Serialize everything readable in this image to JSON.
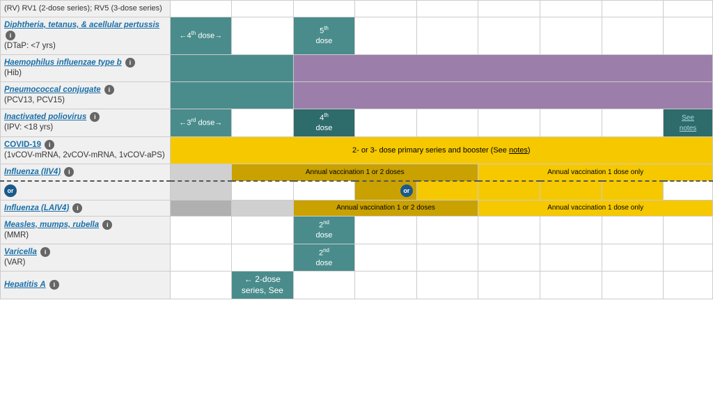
{
  "vaccines": [
    {
      "id": "dtap",
      "nameLink": "Diphtheria, tetanus, & acellular pertussis",
      "nameSub": "(DTaP: <7 yrs)",
      "hasInfo": true,
      "rowType": "normal",
      "cells": [
        {
          "span": 1,
          "color": "teal",
          "text": "←4th dose→",
          "textSize": "small"
        },
        {
          "span": 1,
          "color": "white"
        },
        {
          "span": 1,
          "color": "teal",
          "text": "5th dose",
          "sup": "th",
          "baseText": "5"
        },
        {
          "span": 1,
          "color": "white"
        },
        {
          "span": 1,
          "color": "white"
        },
        {
          "span": 1,
          "color": "white"
        },
        {
          "span": 1,
          "color": "white"
        },
        {
          "span": 1,
          "color": "white"
        },
        {
          "span": 1,
          "color": "white"
        }
      ]
    },
    {
      "id": "hib",
      "nameLink": "Haemophilus influenzae type b",
      "nameSub": "(Hib)",
      "hasInfo": true,
      "rowType": "normal",
      "cells": [
        {
          "span": 2,
          "color": "teal"
        },
        {
          "span": 7,
          "color": "purple"
        }
      ]
    },
    {
      "id": "pcv",
      "nameLink": "Pneumococcal conjugate",
      "nameSub": "(PCV13, PCV15)",
      "hasInfo": true,
      "rowType": "normal",
      "cells": [
        {
          "span": 2,
          "color": "teal"
        },
        {
          "span": 7,
          "color": "purple"
        }
      ]
    },
    {
      "id": "ipv",
      "nameLink": "Inactivated poliovirus",
      "nameSub": "(IPV: <18 yrs)",
      "hasInfo": true,
      "rowType": "normal",
      "cells": [
        {
          "span": 1,
          "color": "teal",
          "text": "←3rd dose→",
          "textSize": "small"
        },
        {
          "span": 1,
          "color": "white"
        },
        {
          "span": 1,
          "color": "teal-dark",
          "text": "4th dose",
          "supText": "th",
          "baseText": "4"
        },
        {
          "span": 1,
          "color": "white"
        },
        {
          "span": 1,
          "color": "white"
        },
        {
          "span": 1,
          "color": "white"
        },
        {
          "span": 1,
          "color": "white"
        },
        {
          "span": 1,
          "color": "white"
        },
        {
          "span": 1,
          "color": "teal-dark",
          "text": "See notes",
          "link": true
        }
      ]
    },
    {
      "id": "covid",
      "nameLink": "COVID-19",
      "nameSub": "(1vCOV-mRNA, 2vCOV-mRNA, 1vCOV-aPS)",
      "hasInfo": true,
      "rowType": "wide",
      "cells": [
        {
          "span": 9,
          "color": "yellow",
          "text": "2- or 3- dose primary series and booster (See notes)",
          "linkWord": "notes"
        }
      ]
    },
    {
      "id": "influenza-iiv4",
      "nameLink": "Influenza (IIV4)",
      "nameSub": "",
      "hasInfo": true,
      "rowType": "normal",
      "cells": [
        {
          "span": 1,
          "color": "gray-light"
        },
        {
          "span": 4,
          "color": "yellow-dark",
          "text": "Annual vaccination 1 or 2 doses",
          "textSize": "small"
        },
        {
          "span": 4,
          "color": "yellow",
          "text": "Annual vaccination 1 dose only",
          "textSize": "small"
        }
      ]
    },
    {
      "id": "or-row",
      "rowType": "or",
      "orBadge": "or"
    },
    {
      "id": "influenza-laiv4",
      "nameLink": "Influenza (LAIV4)",
      "nameSub": "",
      "hasInfo": true,
      "rowType": "normal",
      "dashed": true,
      "cells": [
        {
          "span": 1,
          "color": "gray"
        },
        {
          "span": 1,
          "color": "gray-light"
        },
        {
          "span": 3,
          "color": "yellow-dark",
          "text": "Annual vaccination 1 or 2 doses",
          "textSize": "small"
        },
        {
          "span": 4,
          "color": "yellow",
          "text": "Annual vaccination 1 dose only",
          "textSize": "small"
        }
      ]
    },
    {
      "id": "mmr",
      "nameLink": "Measles, mumps, rubella",
      "nameSub": "(MMR)",
      "hasInfo": true,
      "rowType": "normal",
      "cells": [
        {
          "span": 1,
          "color": "white"
        },
        {
          "span": 1,
          "color": "white"
        },
        {
          "span": 1,
          "color": "teal",
          "text": "2nd dose",
          "sup": "nd",
          "baseText": "2"
        },
        {
          "span": 1,
          "color": "white"
        },
        {
          "span": 1,
          "color": "white"
        },
        {
          "span": 1,
          "color": "white"
        },
        {
          "span": 1,
          "color": "white"
        },
        {
          "span": 1,
          "color": "white"
        },
        {
          "span": 1,
          "color": "white"
        }
      ]
    },
    {
      "id": "varicella",
      "nameLink": "Varicella",
      "nameSub": "(VAR)",
      "hasInfo": true,
      "rowType": "normal",
      "cells": [
        {
          "span": 1,
          "color": "white"
        },
        {
          "span": 1,
          "color": "white"
        },
        {
          "span": 1,
          "color": "teal",
          "text": "2nd dose",
          "sup": "nd",
          "baseText": "2"
        },
        {
          "span": 1,
          "color": "white"
        },
        {
          "span": 1,
          "color": "white"
        },
        {
          "span": 1,
          "color": "white"
        },
        {
          "span": 1,
          "color": "white"
        },
        {
          "span": 1,
          "color": "white"
        },
        {
          "span": 1,
          "color": "white"
        }
      ]
    },
    {
      "id": "hepa",
      "nameLink": "Hepatitis A",
      "nameSub": "",
      "hasInfo": true,
      "rowType": "normal",
      "cells": [
        {
          "span": 1,
          "color": "white"
        },
        {
          "span": 1,
          "color": "teal",
          "text": "← 2-dose series, See"
        },
        {
          "span": 7,
          "color": "white"
        }
      ]
    }
  ],
  "colors": {
    "teal": "#4a8c8c",
    "tealDark": "#2e6b6b",
    "purple": "#9b7eaa",
    "yellow": "#f5c800",
    "yellowDark": "#c9a100",
    "gray": "#b0b0b0",
    "grayLight": "#d0d0d0"
  }
}
